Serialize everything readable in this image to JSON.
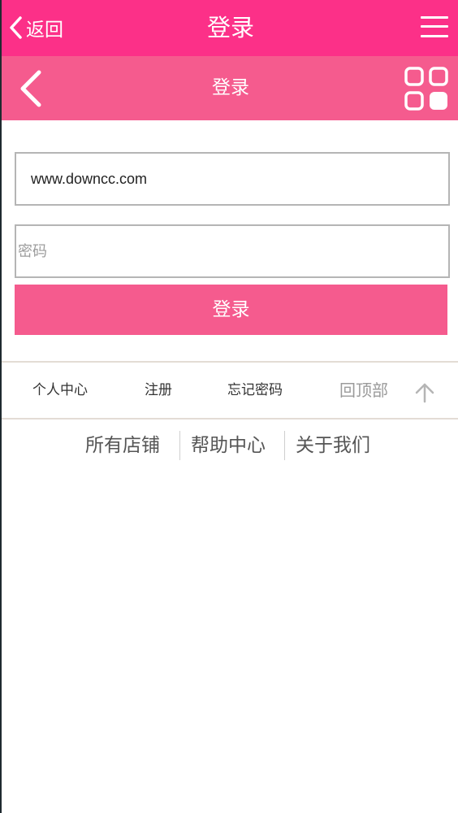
{
  "header": {
    "back_label": "返回",
    "title": "登录",
    "back_icon": "chevron-left-icon",
    "menu_icon": "hamburger-menu-icon"
  },
  "subheader": {
    "title": "登录",
    "back_icon": "chevron-left-icon",
    "grid_icon": "grid-apps-icon"
  },
  "form": {
    "username_value": "www.downcc.com",
    "password_placeholder": "密码",
    "login_label": "登录"
  },
  "quick_links": {
    "personal_center": "个人中心",
    "register": "注册",
    "forgot_password": "忘记密码",
    "back_to_top": "回顶部",
    "up_icon": "arrow-up-icon"
  },
  "footer": {
    "all_stores": "所有店铺",
    "help_center": "帮助中心",
    "about_us": "关于我们"
  },
  "colors": {
    "header_bg": "#fc3088",
    "subheader_bg": "#f55b8e",
    "button_bg": "#f55b8e"
  }
}
